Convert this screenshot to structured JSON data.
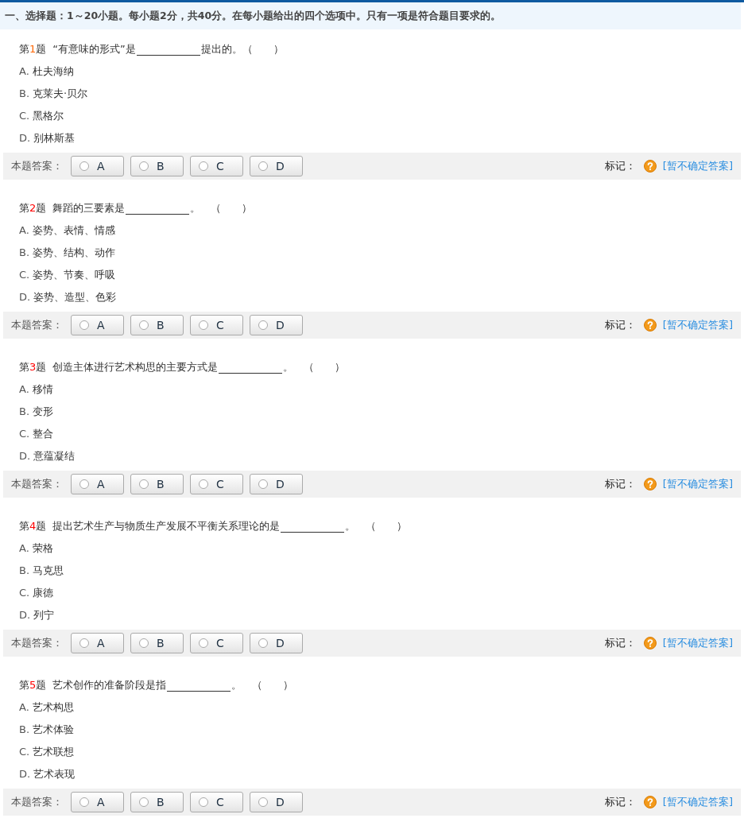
{
  "section_header": "一、选择题：1～20小题。每小题2分，共40分。在每小题给出的四个选项中。只有一项是符合题目要求的。",
  "questions": [
    {
      "prefix": "第",
      "number": "1",
      "suffix": "题",
      "color": "#ff6600",
      "stem_before": "“有意味的形式”是",
      "stem_after": "提出的。（　　）",
      "options": [
        {
          "letter": "A.",
          "text": "杜夫海纳"
        },
        {
          "letter": "B.",
          "text": "克莱夫·贝尔"
        },
        {
          "letter": "C.",
          "text": "黑格尔"
        },
        {
          "letter": "D.",
          "text": "别林斯基"
        }
      ],
      "answer_label": "本题答案：",
      "answers": [
        {
          "label": "A",
          "selected": false
        },
        {
          "label": "B",
          "selected": false
        },
        {
          "label": "C",
          "selected": false
        },
        {
          "label": "D",
          "selected": false
        }
      ],
      "mark_label": "标记：",
      "mark_link": "[暂不确定答案]"
    },
    {
      "prefix": "第",
      "number": "2",
      "suffix": "题",
      "color": "#ff0000",
      "stem_before": "舞蹈的三要素是",
      "stem_after": "。　（　　）",
      "options": [
        {
          "letter": "A.",
          "text": "姿势、表情、情感"
        },
        {
          "letter": "B.",
          "text": "姿势、结构、动作"
        },
        {
          "letter": "C.",
          "text": "姿势、节奏、呼吸"
        },
        {
          "letter": "D.",
          "text": "姿势、造型、色彩"
        }
      ],
      "answer_label": "本题答案：",
      "answers": [
        {
          "label": "A",
          "selected": false
        },
        {
          "label": "B",
          "selected": false
        },
        {
          "label": "C",
          "selected": false
        },
        {
          "label": "D",
          "selected": false
        }
      ],
      "mark_label": "标记：",
      "mark_link": "[暂不确定答案]"
    },
    {
      "prefix": "第",
      "number": "3",
      "suffix": "题",
      "color": "#ff0000",
      "stem_before": "创造主体进行艺术构思的主要方式是",
      "stem_after": "。　（　　）",
      "options": [
        {
          "letter": "A.",
          "text": "移情"
        },
        {
          "letter": "B.",
          "text": "变形"
        },
        {
          "letter": "C.",
          "text": "整合"
        },
        {
          "letter": "D.",
          "text": "意蕴凝结"
        }
      ],
      "answer_label": "本题答案：",
      "answers": [
        {
          "label": "A",
          "selected": false
        },
        {
          "label": "B",
          "selected": false
        },
        {
          "label": "C",
          "selected": false
        },
        {
          "label": "D",
          "selected": false
        }
      ],
      "mark_label": "标记：",
      "mark_link": "[暂不确定答案]"
    },
    {
      "prefix": "第",
      "number": "4",
      "suffix": "题",
      "color": "#ff0000",
      "stem_before": "提出艺术生产与物质生产发展不平衡关系理论的是",
      "stem_after": "。　（　　）",
      "options": [
        {
          "letter": "A.",
          "text": "荣格"
        },
        {
          "letter": "B.",
          "text": "马克思"
        },
        {
          "letter": "C.",
          "text": "康德"
        },
        {
          "letter": "D.",
          "text": "列宁"
        }
      ],
      "answer_label": "本题答案：",
      "answers": [
        {
          "label": "A",
          "selected": false
        },
        {
          "label": "B",
          "selected": false
        },
        {
          "label": "C",
          "selected": false
        },
        {
          "label": "D",
          "selected": false
        }
      ],
      "mark_label": "标记：",
      "mark_link": "[暂不确定答案]"
    },
    {
      "prefix": "第",
      "number": "5",
      "suffix": "题",
      "color": "#ff0000",
      "stem_before": "艺术创作的准备阶段是指",
      "stem_after": "。　（　　）",
      "options": [
        {
          "letter": "A.",
          "text": "艺术构思"
        },
        {
          "letter": "B.",
          "text": "艺术体验"
        },
        {
          "letter": "C.",
          "text": "艺术联想"
        },
        {
          "letter": "D.",
          "text": "艺术表现"
        }
      ],
      "answer_label": "本题答案：",
      "answers": [
        {
          "label": "A",
          "selected": false
        },
        {
          "label": "B",
          "selected": false
        },
        {
          "label": "C",
          "selected": false
        },
        {
          "label": "D",
          "selected": false
        }
      ],
      "mark_label": "标记：",
      "mark_link": "[暂不确定答案]"
    }
  ]
}
